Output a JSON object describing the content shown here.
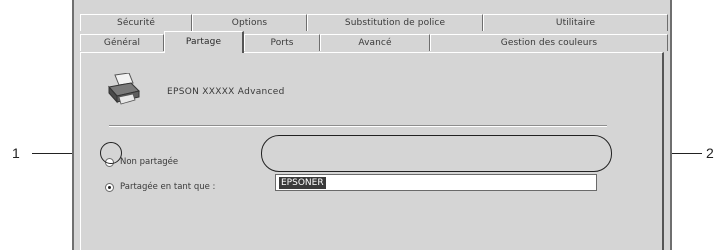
{
  "tabs": {
    "back_row": [
      "Sécurité",
      "Options",
      "Substitution de police",
      "Utilitaire"
    ],
    "front_row": [
      "Général",
      "Partage",
      "Ports",
      "Avancé",
      "Gestion des couleurs"
    ],
    "active": "Partage"
  },
  "printer": {
    "icon": "printer-icon",
    "name": "EPSON  XXXXX  Advanced"
  },
  "sharing": {
    "not_shared_label": "Non partagée",
    "shared_as_label": "Partagée en tant que :",
    "selected": "shared_as",
    "share_name_value": "EPSONER"
  },
  "callouts": {
    "left_number": "1",
    "right_number": "2"
  }
}
